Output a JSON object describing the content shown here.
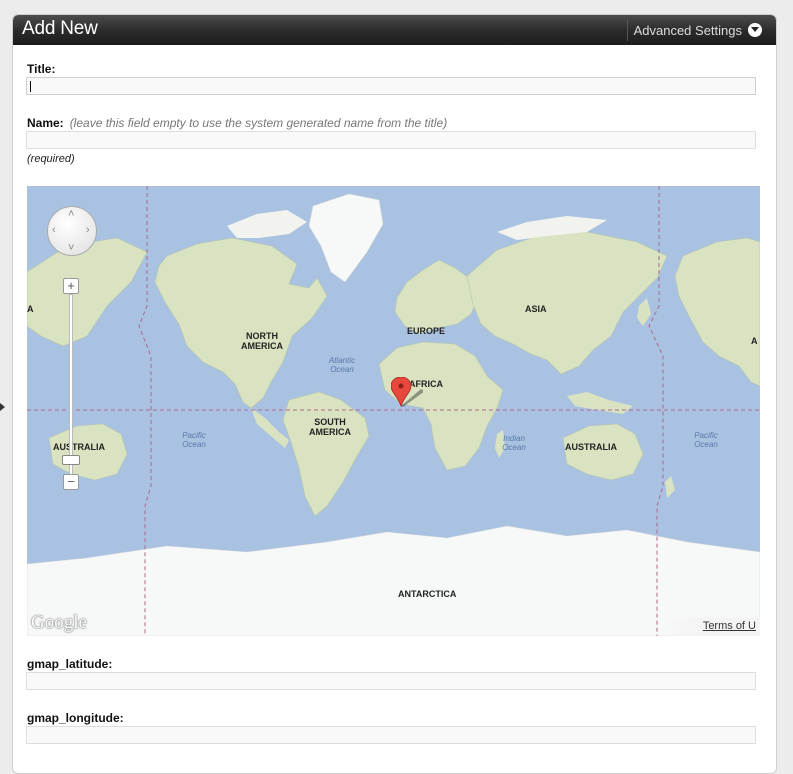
{
  "panel": {
    "title": "Add New",
    "advanced_settings": "Advanced Settings"
  },
  "form": {
    "title_label": "Title:",
    "title_value": "",
    "name_label": "Name:",
    "name_hint": "(leave this field empty to use the system generated name from the title)",
    "name_value": "",
    "required_note": "(required)",
    "lat_label": "gmap_latitude:",
    "lat_value": "",
    "lng_label": "gmap_longitude:",
    "lng_value": ""
  },
  "map": {
    "continents": [
      "NORTH AMERICA",
      "SOUTH AMERICA",
      "EUROPE",
      "AFRICA",
      "ASIA",
      "AUSTRALIA",
      "AUSTRALIA",
      "ANTARCTICA"
    ],
    "oceans": [
      "Atlantic Ocean",
      "Pacific Ocean",
      "Indian Ocean",
      "Pacific Ocean"
    ],
    "edge_fragment": "A",
    "watermark": "Google",
    "terms": "Terms of U",
    "zoom_in": "+",
    "zoom_out": "−",
    "colors": {
      "water": "#a9c2e2",
      "land": "#d9e3c1",
      "ice": "#f7f8f8",
      "marker": "#e8473b"
    }
  },
  "icons": [
    "chevron-down-icon",
    "pan-control-icon",
    "zoom-in-icon",
    "zoom-out-icon",
    "map-marker-icon"
  ]
}
